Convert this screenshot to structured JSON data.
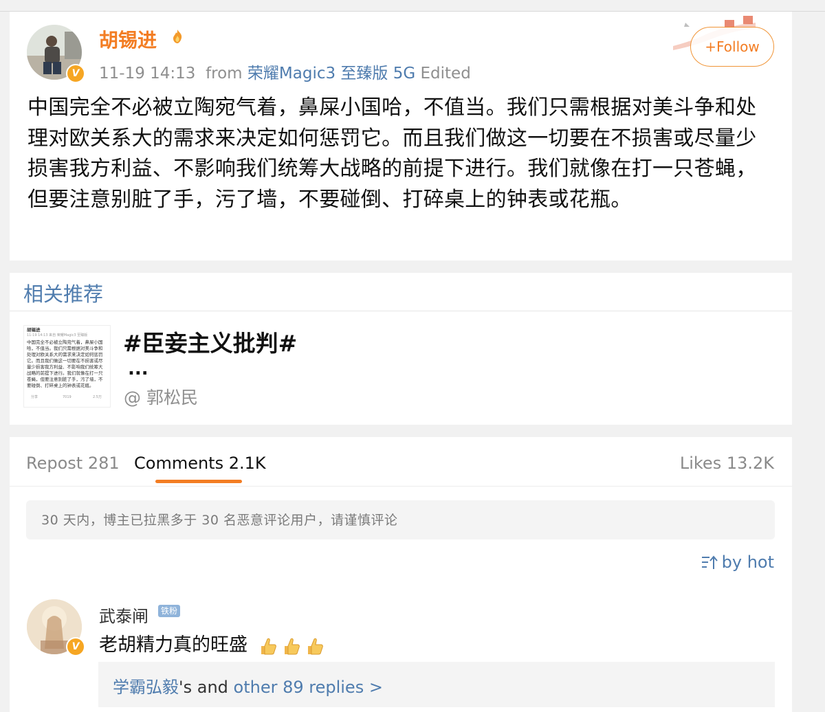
{
  "post": {
    "author_name": "胡锡进",
    "timestamp": "11-19 14:13",
    "from_label": "from",
    "source_device": "荣耀Magic3 至臻版 5G",
    "edited_label": "Edited",
    "follow_label": "+Follow",
    "body": "中国完全不必被立陶宛气着，鼻屎小国哈，不值当。我们只需根据对美斗争和处理对欧关系大的需求来决定如何惩罚它。而且我们做这一切要在不损害或尽量少损害我方利益、不影响我们统筹大战略的前提下进行。我们就像在打一只苍蝇，但要注意别脏了手，污了墙，不要碰倒、打碎桌上的钟表或花瓶。"
  },
  "related": {
    "title": "相关推荐",
    "topic": "#臣妾主义批判#",
    "ellipsis": "...",
    "author": "@ 郭松民",
    "thumb": {
      "name": "胡锡进",
      "meta": "11-19 14:13  来自 荣耀Magic3 至臻版",
      "lines": [
        "中国完全不必被立陶宛气着，鼻屎小国",
        "哈，不值当。我们只需根据对美斗争和",
        "处理对欧关系大的需求来决定如何惩罚",
        "它。而且我们做这一切要在不损害或尽",
        "量少损害我方利益、不影响我们统筹大",
        "战略的前提下进行。我们就像在打一只",
        "苍蝇，但要注意别脏了手，污了墙，不",
        "要碰倒、打碎桌上的钟表或花瓶。"
      ],
      "stats": [
        "分享",
        "7019",
        "2.5万"
      ]
    }
  },
  "comments_section": {
    "tabs": {
      "repost": "Repost 281",
      "comments": "Comments 2.1K",
      "likes": "Likes 13.2K"
    },
    "notice": "30 天内，博主已拉黑多于 30 名恶意评论用户，请谨慎评论",
    "sort_label": "by hot",
    "comment": {
      "user": "武泰闸",
      "badge": "铁粉",
      "text": "老胡精力真的旺盛",
      "replies_user": "学霸弘毅",
      "replies_mid": "'s and ",
      "replies_link": "other 89 replies >"
    }
  },
  "colors": {
    "accent_orange": "#f37d23",
    "link_blue": "#4f7cae",
    "vip_gold": "#f6a623"
  },
  "icons": [
    "flame-icon",
    "verified-v-icon",
    "sort-icon",
    "thumbs-up-icon",
    "great-wall-decoration"
  ]
}
